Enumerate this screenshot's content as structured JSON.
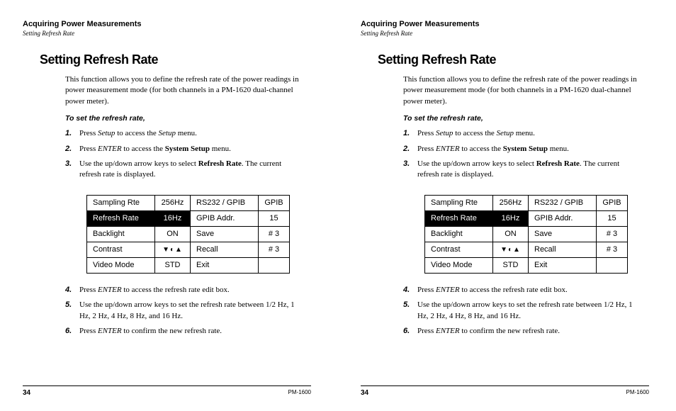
{
  "header": {
    "chapter": "Acquiring Power Measurements",
    "section": "Setting Refresh Rate"
  },
  "title": "Setting Refresh Rate",
  "intro": "This function allows you to define the refresh rate of the power readings in power measurement mode (for both channels in a PM-1620 dual-channel power meter).",
  "procedure_title": "To set the refresh rate,",
  "steps": {
    "n1": "1.",
    "s1a": "Press ",
    "s1b": "Setup",
    "s1c": " to access the ",
    "s1d": "Setup",
    "s1e": " menu.",
    "n2": "2.",
    "s2a": "Press ",
    "s2b": "ENTER",
    "s2c": " to access the ",
    "s2d": "System Setup",
    "s2e": " menu.",
    "n3": "3.",
    "s3a": "Use the up/down arrow keys to select ",
    "s3b": "Refresh Rate",
    "s3c": ". The current refresh rate is displayed.",
    "n4": "4.",
    "s4a": "Press ",
    "s4b": "ENTER",
    "s4c": " to access the refresh rate edit box.",
    "n5": "5.",
    "s5a": "Use the up/down arrow keys to set the refresh rate between 1/2 Hz, 1 Hz, 2 Hz, 4 Hz, 8 Hz, and 16 Hz.",
    "n6": "6.",
    "s6a": "Press ",
    "s6b": "ENTER",
    "s6c": " to confirm the new refresh rate."
  },
  "table": {
    "r1c1": "Sampling Rte",
    "r1c2": "256Hz",
    "r1c3": "RS232 / GPIB",
    "r1c4": "GPIB",
    "r2c1": "Refresh Rate",
    "r2c2": "16Hz",
    "r2c3": "GPIB Addr.",
    "r2c4": "15",
    "r3c1": "Backlight",
    "r3c2": "ON",
    "r3c3": "Save",
    "r3c4": "# 3",
    "r4c1": "Contrast",
    "r4c2": "▼◐▲",
    "r4c3": "Recall",
    "r4c4": "# 3",
    "r5c1": "Video Mode",
    "r5c2": "STD",
    "r5c3": "Exit",
    "r5c4": ""
  },
  "footer": {
    "pagenum": "34",
    "model": "PM-1600"
  }
}
